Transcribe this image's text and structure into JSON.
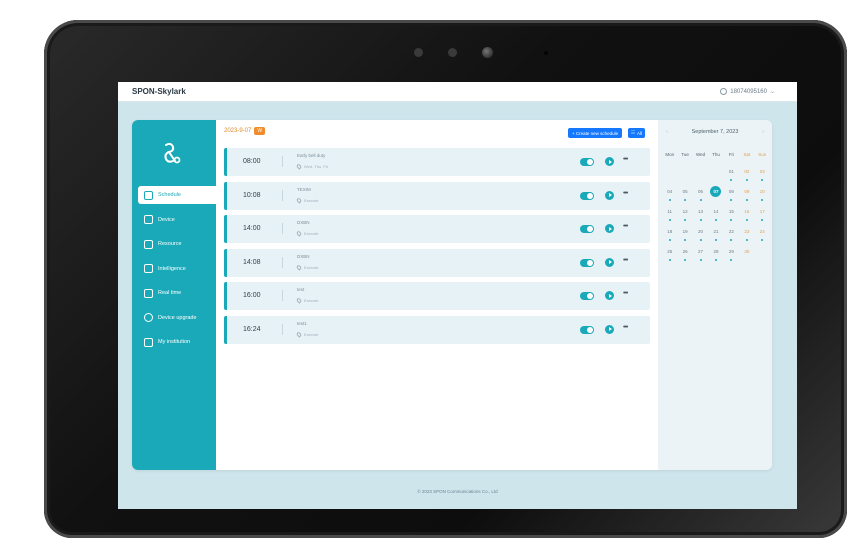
{
  "app": {
    "title": "SPON-Skylark",
    "user": "18074095160"
  },
  "main": {
    "date_label": "2023-9-07",
    "date_badge": "W",
    "create_button": "+ Create new schedule",
    "all_button": "All"
  },
  "sidebar": {
    "items": [
      {
        "label": "Schedule",
        "icon": "calendar-icon",
        "active": true
      },
      {
        "label": "Device",
        "icon": "device-icon",
        "active": false
      },
      {
        "label": "Resource",
        "icon": "file-icon",
        "active": false
      },
      {
        "label": "Intelligence",
        "icon": "intelligence-icon",
        "active": false
      },
      {
        "label": "Real time",
        "icon": "clock-icon",
        "active": false
      },
      {
        "label": "Device upgrade",
        "icon": "upgrade-icon",
        "active": false
      },
      {
        "label": "My institution",
        "icon": "institution-icon",
        "active": false
      }
    ]
  },
  "schedules": [
    {
      "time": "08:00",
      "name": "Early bell duty",
      "sub": "Wed, Thu, Fri",
      "enabled": true
    },
    {
      "time": "10:08",
      "name": "TEXIM",
      "sub": "Execute",
      "enabled": true
    },
    {
      "time": "14:00",
      "name": "DXBN",
      "sub": "Execute",
      "enabled": true
    },
    {
      "time": "14:08",
      "name": "DXBN",
      "sub": "Execute",
      "enabled": true
    },
    {
      "time": "16:00",
      "name": "test",
      "sub": "Execute",
      "enabled": true
    },
    {
      "time": "16:24",
      "name": "test1",
      "sub": "Execute",
      "enabled": true
    }
  ],
  "calendar": {
    "title": "September 7, 2023",
    "weekdays": [
      "Mon",
      "Tue",
      "Wed",
      "Thu",
      "Fri",
      "Sat",
      "Sun"
    ],
    "days": [
      {
        "n": "",
        "w": false,
        "dot": false
      },
      {
        "n": "",
        "w": false,
        "dot": false
      },
      {
        "n": "",
        "w": false,
        "dot": false
      },
      {
        "n": "",
        "w": false,
        "dot": false
      },
      {
        "n": "01",
        "w": false,
        "dot": true
      },
      {
        "n": "02",
        "w": true,
        "dot": true
      },
      {
        "n": "03",
        "w": true,
        "dot": true
      },
      {
        "n": "04",
        "w": false,
        "dot": true
      },
      {
        "n": "05",
        "w": false,
        "dot": true
      },
      {
        "n": "06",
        "w": false,
        "dot": true
      },
      {
        "n": "07",
        "w": false,
        "dot": false,
        "today": true
      },
      {
        "n": "08",
        "w": false,
        "dot": true
      },
      {
        "n": "09",
        "w": true,
        "dot": true
      },
      {
        "n": "10",
        "w": true,
        "dot": true
      },
      {
        "n": "11",
        "w": false,
        "dot": true
      },
      {
        "n": "12",
        "w": false,
        "dot": true
      },
      {
        "n": "13",
        "w": false,
        "dot": true
      },
      {
        "n": "14",
        "w": false,
        "dot": true
      },
      {
        "n": "15",
        "w": false,
        "dot": true
      },
      {
        "n": "16",
        "w": true,
        "dot": true
      },
      {
        "n": "17",
        "w": true,
        "dot": true
      },
      {
        "n": "18",
        "w": false,
        "dot": true
      },
      {
        "n": "19",
        "w": false,
        "dot": true
      },
      {
        "n": "20",
        "w": false,
        "dot": true
      },
      {
        "n": "21",
        "w": false,
        "dot": true
      },
      {
        "n": "22",
        "w": false,
        "dot": true
      },
      {
        "n": "23",
        "w": true,
        "dot": true
      },
      {
        "n": "24",
        "w": true,
        "dot": true
      },
      {
        "n": "25",
        "w": false,
        "dot": true
      },
      {
        "n": "26",
        "w": false,
        "dot": true
      },
      {
        "n": "27",
        "w": false,
        "dot": true
      },
      {
        "n": "28",
        "w": false,
        "dot": true
      },
      {
        "n": "29",
        "w": false,
        "dot": true
      },
      {
        "n": "30",
        "w": true,
        "dot": false
      }
    ]
  },
  "footer": "© 2023 SPON Communications Co., Ltd",
  "colors": {
    "accent": "#1aa9b8",
    "primary_button": "#1677ff",
    "date_badge": "#f08c2c",
    "screen_bg": "#cfe5ec"
  }
}
